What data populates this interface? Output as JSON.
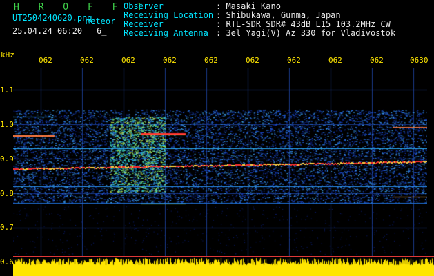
{
  "header": {
    "app_title": "H R O F F T",
    "filename": "UT2504240620.png",
    "tag": "meteor",
    "datetime": "25.04.24 06:20",
    "small_value": "6_",
    "fields": [
      {
        "label": "Observer",
        "value": ": Masaki Kano"
      },
      {
        "label": "Receiving Location",
        "value": ": Shibukawa, Gunma, Japan"
      },
      {
        "label": "Receiver",
        "value": ": RTL-SDR SDR# 43dB L15 103.2MHz CW"
      },
      {
        "label": "Receiving Antenna",
        "value": ": 3el Yagi(V) Az 330 for Vladivostok"
      }
    ]
  },
  "axis": {
    "unit": "kHz",
    "y_ticks": [
      "1.1",
      "1.0",
      "0.9",
      "0.8",
      "0.7",
      "0.6"
    ],
    "time_labels": [
      "062",
      "062",
      "062",
      "062",
      "062",
      "062",
      "062",
      "062",
      "062",
      "0630"
    ]
  },
  "colors": {
    "background": "#000000",
    "grid": "#1a3a8a",
    "text_cyan": "#00e5ff",
    "text_yellow": "#ffe600",
    "text_green": "#3fd24a",
    "signal_red": "#ff3030",
    "noise_blue": "#1838b8"
  }
}
